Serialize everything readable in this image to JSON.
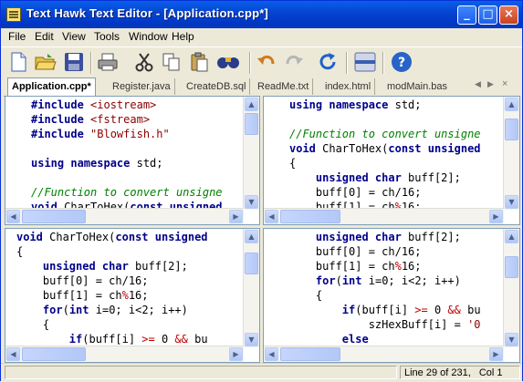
{
  "window": {
    "title": "Text Hawk Text Editor - [Application.cpp*]"
  },
  "menu": [
    "File",
    "Edit",
    "View",
    "Tools",
    "Window",
    "Help"
  ],
  "toolbar": [
    "new-file",
    "open-folder",
    "save",
    "print",
    "cut",
    "copy",
    "paste",
    "find",
    "undo",
    "redo",
    "refresh",
    "split-view",
    "help"
  ],
  "tabs": [
    {
      "label": "Application.cpp*",
      "active": true
    },
    {
      "label": "Register.java"
    },
    {
      "label": "CreateDB.sql"
    },
    {
      "label": "ReadMe.txt"
    },
    {
      "label": "index.html"
    },
    {
      "label": "modMain.bas"
    }
  ],
  "status": {
    "position": "Line 29 of 231,",
    "column": "Col 1"
  },
  "colors": {
    "keyword": "#00008b",
    "string": "#8b0000",
    "comment": "#008000",
    "operator": "#c00000",
    "titlebar": "#0546d2"
  }
}
